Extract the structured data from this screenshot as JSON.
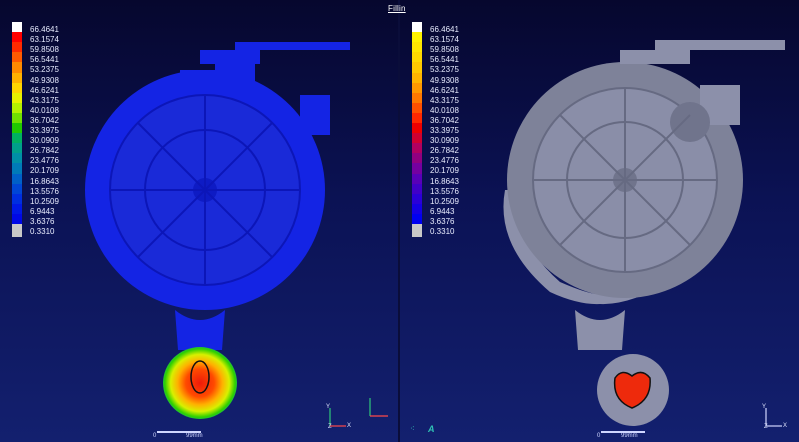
{
  "window": {
    "title": "Fillin"
  },
  "legend_left": {
    "labels": [
      "66.4641",
      "63.1574",
      "59.8508",
      "56.5441",
      "53.2375",
      "49.9308",
      "46.6241",
      "43.3175",
      "40.0108",
      "36.7042",
      "33.3975",
      "30.0909",
      "26.7842",
      "23.4776",
      "20.1709",
      "16.8643",
      "13.5576",
      "10.2509",
      "6.9443",
      "3.6376",
      "0.3310"
    ],
    "colors": [
      "#ffffff",
      "#ff0000",
      "#ff2a00",
      "#ff5a00",
      "#ff8a00",
      "#ffb000",
      "#ffd400",
      "#e8f000",
      "#b4f000",
      "#70e000",
      "#20c800",
      "#00b060",
      "#00a08a",
      "#008fa6",
      "#007ab8",
      "#0060c8",
      "#0046d6",
      "#002ee0",
      "#0018e6",
      "#0008e6",
      "#c8c8c8"
    ]
  },
  "legend_right": {
    "labels": [
      "66.4641",
      "63.1574",
      "59.8508",
      "56.5441",
      "53.2375",
      "49.9308",
      "46.6241",
      "43.3175",
      "40.0108",
      "36.7042",
      "33.3975",
      "30.0909",
      "26.7842",
      "23.4776",
      "20.1709",
      "16.8643",
      "13.5576",
      "10.2509",
      "6.9443",
      "3.6376",
      "0.3310"
    ],
    "colors": [
      "#ffffff",
      "#fff200",
      "#ffe600",
      "#ffd800",
      "#ffc800",
      "#ffb400",
      "#ff9800",
      "#ff7800",
      "#ff5000",
      "#ff2800",
      "#ee0000",
      "#d00030",
      "#b00060",
      "#900080",
      "#7400a0",
      "#5800b8",
      "#4000c8",
      "#2a00d8",
      "#1400e4",
      "#0000f0",
      "#c8c8c8"
    ],
    "zero_values": [
      "0",
      "0",
      "0",
      "0",
      "0",
      "0",
      "0",
      "0",
      "0",
      "0",
      "0",
      "0",
      "0",
      "0",
      "0",
      "0",
      "0",
      "0",
      "0",
      "0",
      "0"
    ]
  },
  "scale_left": {
    "start": "0",
    "end": "99mm"
  },
  "scale_right": {
    "start": "0",
    "end": "99mm"
  },
  "axes": {
    "y": "Y",
    "z": "Z",
    "x": "X"
  },
  "brand": {
    "letter": "A"
  },
  "colors": {
    "part_blue": "#0f1ee6",
    "part_gray": "#8a8fa8",
    "hot_red": "#ee2a0c"
  }
}
